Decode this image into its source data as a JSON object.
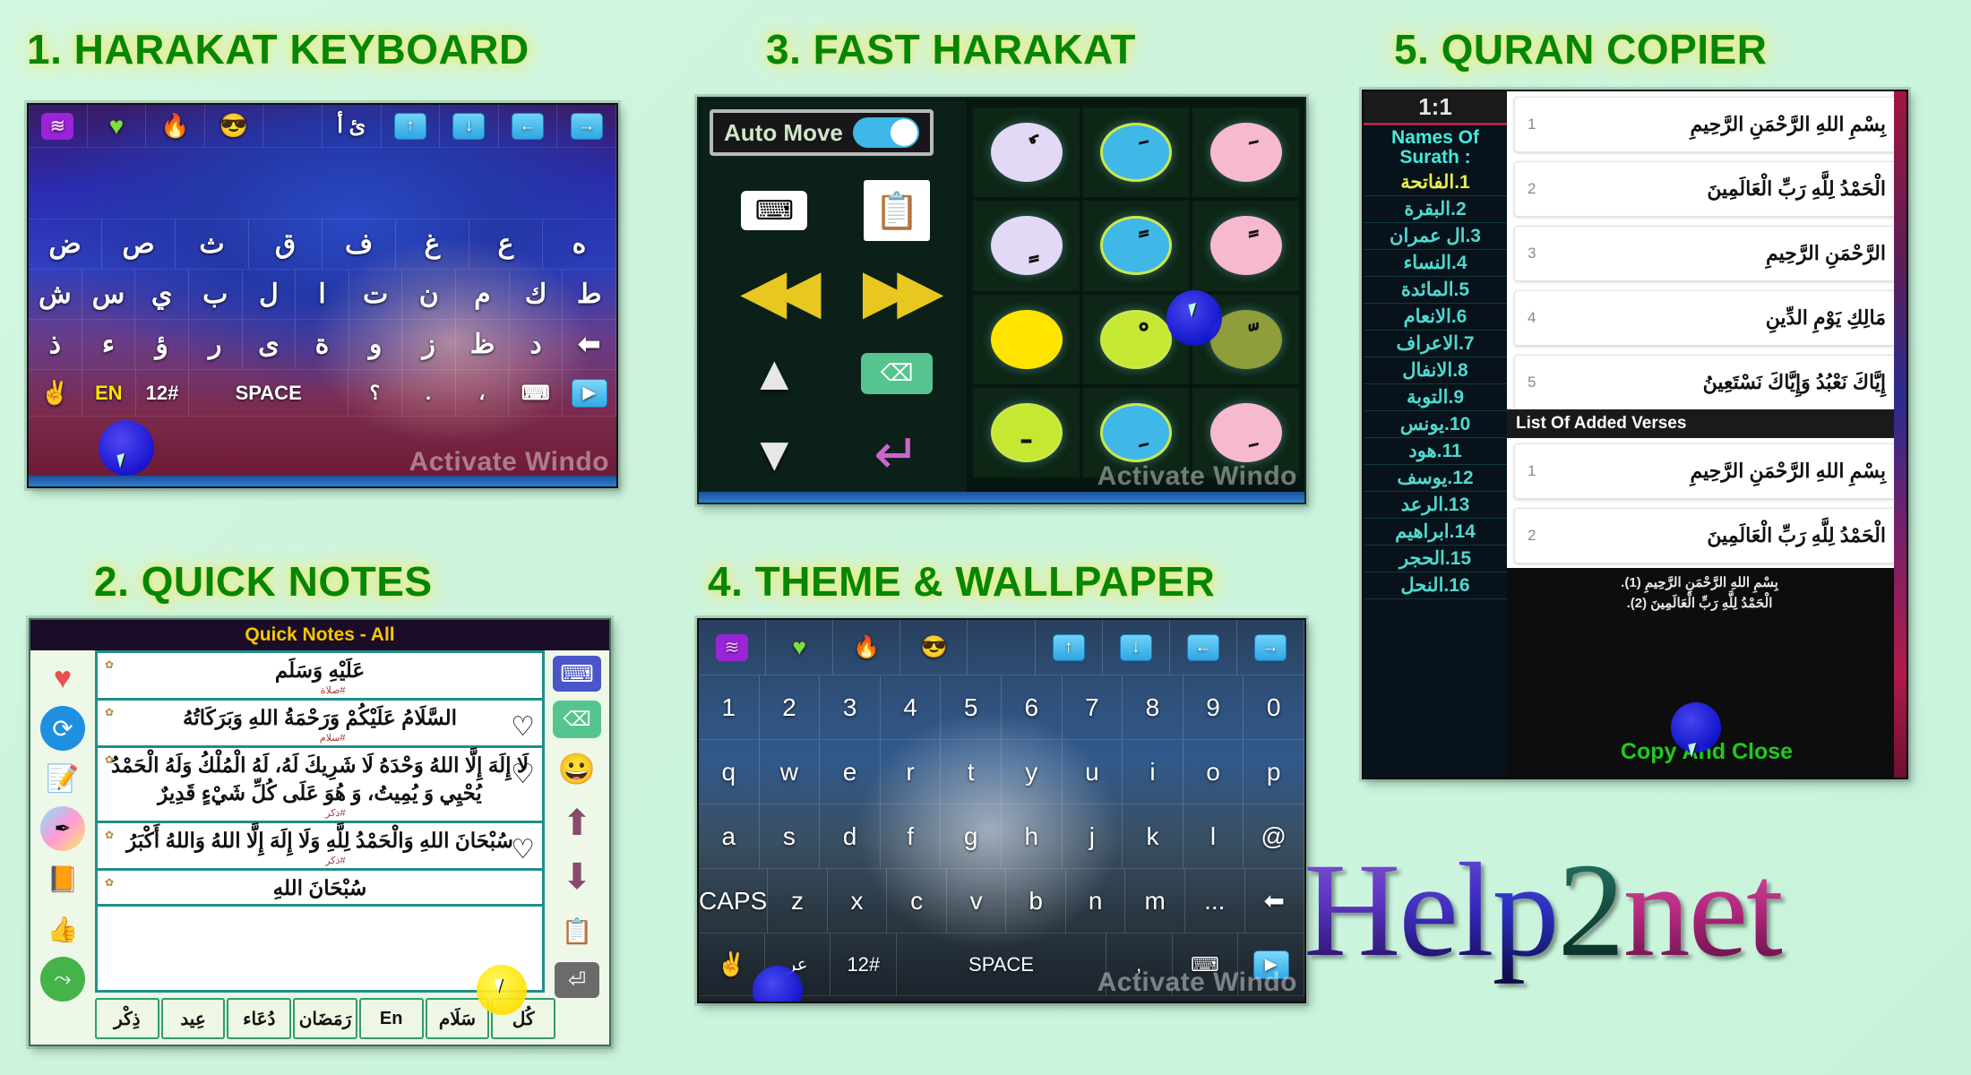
{
  "titles": {
    "t1": "1. HARAKAT KEYBOARD",
    "t2": "2. QUICK NOTES",
    "t3": "3. FAST HARAKAT",
    "t4": "4. THEME & WALLPAPER",
    "t5": "5. QURAN COPIER"
  },
  "brand": {
    "logo_text": "Help2net",
    "letters": [
      "H",
      "e",
      "l",
      "p",
      "2",
      "n",
      "e",
      "t"
    ]
  },
  "watermark": "Activate Windo",
  "panel1": {
    "icon_row": [
      "wave-icon",
      "green-heart",
      "fire",
      "sunglasses-smiley",
      "",
      "",
      "arrow-up",
      "arrow-down",
      "arrow-left",
      "arrow-right"
    ],
    "suggestion_row": [
      "ئ",
      "أ"
    ],
    "letters_row1": [
      "ض",
      "ص",
      "ث",
      "ق",
      "ف",
      "غ",
      "ع",
      "ه"
    ],
    "letters_row2": [
      "ش",
      "س",
      "ي",
      "ب",
      "ل",
      "ا",
      "ت",
      "ن",
      "م",
      "ك",
      "ط"
    ],
    "letters_row3": [
      "ذ",
      "ء",
      "ؤ",
      "ر",
      "ى",
      "ة",
      "و",
      "ز",
      "ظ",
      "د",
      "backspace"
    ],
    "bottom_row": [
      "✌",
      "EN",
      "12#",
      "SPACE",
      "؟",
      ".",
      "،",
      "keyboard-icon",
      "play-icon"
    ],
    "lang_label": "EN",
    "num_label": "12#",
    "space_label": "SPACE"
  },
  "panel2": {
    "header": "Quick Notes - All",
    "left_icons": [
      "heart-icon",
      "refresh-icon",
      "edit-note-icon",
      "palette-icon",
      "quran-book-icon",
      "thumbs-up-icon",
      "share-icon"
    ],
    "right_icons": [
      "keyboard-icon",
      "backspace-icon",
      "emoji-icon",
      "arrow-up-icon",
      "arrow-down-icon",
      "clipboard-icon",
      "enter-icon"
    ],
    "notes": [
      {
        "text": "عَلَيْهِ وَسَلَم",
        "tag": "#صلاة",
        "fav": false
      },
      {
        "text": "السَّلَامُ عَلَيْكُمْ وَرَحْمَةُ اللهِ وَبَرَكَاتُهُ",
        "tag": "#سلام",
        "fav": true
      },
      {
        "text": "لَا إِلَهَ إِلَّا اللهُ وَحْدَهُ لَا شَرِيكَ لَهُ، لَهُ الْمُلْكُ وَلَهُ الْحَمْدُ يُحْيِي وَ يُمِيتُ، وَ هُوَ عَلَى كُلِّ شَيْءٍ قَدِيرٌ",
        "tag": "#ذكر",
        "fav": true
      },
      {
        "text": "سُبْحَانَ اللهِ وَالْحَمْدُ لِلَّهِ وَلَا إِلَهَ إِلَّا اللهُ وَاللهُ أَكْبَرُ",
        "tag": "#ذكر",
        "fav": true
      },
      {
        "text": "سُبْحَانَ اللهِ",
        "tag": "",
        "fav": false
      }
    ],
    "tags": [
      "كُل",
      "سَلَام",
      "En",
      "رَمَضَان",
      "دُعَاء",
      "عِيد",
      "ذِكْر"
    ]
  },
  "panel3": {
    "auto_move_label": "Auto Move",
    "auto_move_on": true,
    "left_buttons": [
      "keyboard-icon",
      "clipboard-icon",
      "rewind-icon",
      "fast-forward-icon",
      "arrow-up-icon",
      "backspace-icon",
      "arrow-down-icon",
      "enter-icon"
    ],
    "harakat": [
      {
        "mark": "ٗ",
        "color": "#e3d8f5"
      },
      {
        "mark": "َ",
        "color": "#3fb8e8"
      },
      {
        "mark": "َ",
        "color": "#f7b9cf"
      },
      {
        "mark": "ٍٍ",
        "color": "#e3d8f5"
      },
      {
        "mark": "ً",
        "color": "#3fb8e8"
      },
      {
        "mark": "ً",
        "color": "#f7b9cf"
      },
      {
        "mark": "",
        "color": "#ffe400"
      },
      {
        "mark": "ْ",
        "color": "#c5e832"
      },
      {
        "mark": "ّ",
        "color": "#8f9d3a"
      },
      {
        "mark": "ـ",
        "color": "#c5e832"
      },
      {
        "mark": "ِ",
        "color": "#3fb8e8"
      },
      {
        "mark": "ِ",
        "color": "#f7b9cf"
      }
    ]
  },
  "panel4": {
    "icon_row": [
      "wave-icon",
      "green-heart",
      "fire",
      "sunglasses-smiley",
      "",
      "arrow-up",
      "arrow-down",
      "arrow-left",
      "arrow-right"
    ],
    "num_row": [
      "1",
      "2",
      "3",
      "4",
      "5",
      "6",
      "7",
      "8",
      "9",
      "0"
    ],
    "row_q": [
      "q",
      "w",
      "e",
      "r",
      "t",
      "y",
      "u",
      "i",
      "o",
      "p"
    ],
    "row_a": [
      "a",
      "s",
      "d",
      "f",
      "g",
      "h",
      "j",
      "k",
      "l",
      "@"
    ],
    "row_z": [
      "CAPS",
      "z",
      "x",
      "c",
      "v",
      "b",
      "n",
      "m",
      "...",
      "⬅"
    ],
    "bottom_row": [
      "✌",
      "عر",
      "12#",
      "SPACE",
      ",",
      "keyboard-icon",
      "play-icon"
    ]
  },
  "panel5": {
    "ratio": "1:1",
    "names_of_surath": "Names Of Surath :",
    "surahs": [
      "1.الفاتحة",
      "2.البقرة",
      "3.ال عمران",
      "4.النساء",
      "5.المائدة",
      "6.الانعام",
      "7.الاعراف",
      "8.الانفال",
      "9.التوبة",
      "10.يونس",
      "11.هود",
      "12.يوسف",
      "13.الرعد",
      "14.ابراهيم",
      "15.الحجر",
      "16.النحل"
    ],
    "selected_surah_index": 0,
    "verses": [
      {
        "num": "1",
        "text": "بِسْمِ اللهِ الرَّحْمَنِ الرَّحِيمِ"
      },
      {
        "num": "2",
        "text": "الْحَمْدُ لِلَّهِ رَبِّ الْعَالَمِينَ"
      },
      {
        "num": "3",
        "text": "الرَّحْمَنِ الرَّحِيمِ"
      },
      {
        "num": "4",
        "text": "مَالِكِ يَوْمِ الدِّينِ"
      },
      {
        "num": "5",
        "text": "إِيَّاكَ نَعْبُدُ وَإِيَّاكَ نَسْتَعِينُ"
      }
    ],
    "added_header": "List Of Added Verses",
    "added_verses": [
      {
        "num": "1",
        "text": "بِسْمِ اللهِ الرَّحْمَنِ الرَّحِيمِ"
      },
      {
        "num": "2",
        "text": "الْحَمْدُ لِلَّهِ رَبِّ الْعَالَمِينَ"
      }
    ],
    "preview_lines": [
      "بِسْمِ اللهِ الرَّحْمَنِ الرَّحِيمِ (1).",
      "الْحَمْدُ لِلَّهِ رَبِّ الْعَالَمِينَ (2)."
    ],
    "copy_button": "Copy And Close"
  }
}
